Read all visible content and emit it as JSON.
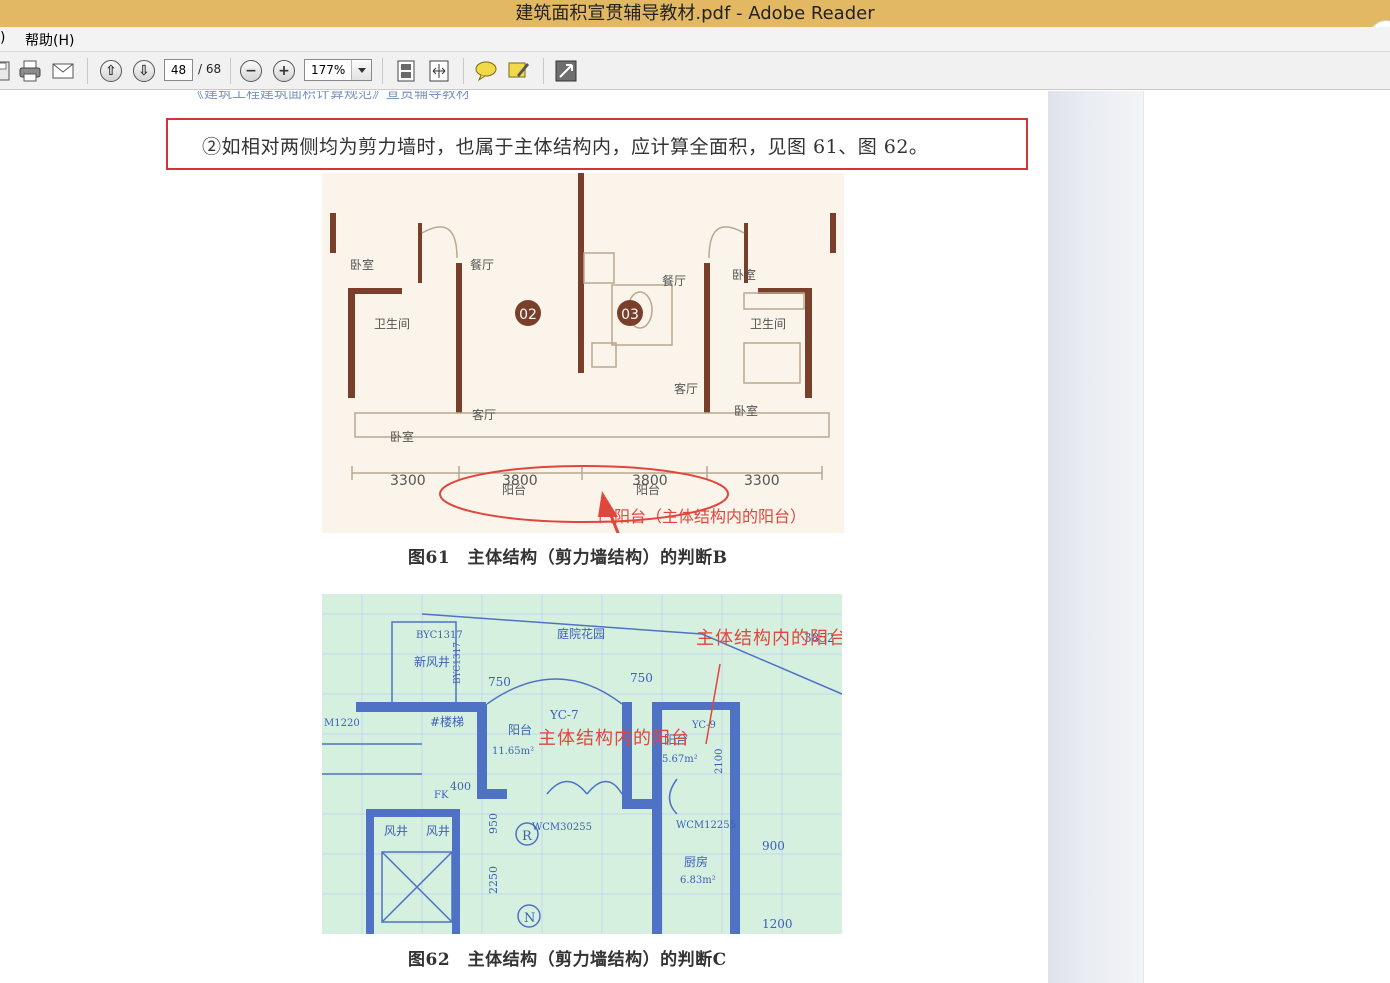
{
  "window": {
    "title": "建筑面积宣贯辅导教材.pdf - Adobe Reader"
  },
  "menubar": {
    "partial_item": ")",
    "help": "帮助(H)"
  },
  "toolbar": {
    "page_current": "48",
    "page_total": "/ 68",
    "zoom": "177%",
    "icons": [
      "save-icon",
      "print-icon",
      "email-icon",
      "prev-page-icon",
      "next-page-icon",
      "zoom-out-icon",
      "zoom-in-icon",
      "fit-page-icon",
      "fit-width-icon",
      "comment-icon",
      "highlight-icon",
      "fullscreen-icon"
    ]
  },
  "document": {
    "running_header": "《建筑工程建筑面积计算规范》宣贯辅导教材",
    "highlighted_text": "②如相对两侧均为剪力墙时，也属于主体结构内，应计算全面积，见图 61、图 62。",
    "figure61": {
      "caption": "图61　主体结构（剪力墙结构）的判断B",
      "rooms": [
        "餐厅",
        "卧室",
        "餐厅",
        "卧室",
        "卫生间",
        "卫生间",
        "卧室",
        "客厅",
        "客厅",
        "卧室",
        "阳台",
        "阳台"
      ],
      "unit_labels": [
        "02",
        "03"
      ],
      "dimensions": [
        "3300",
        "3800",
        "3800",
        "3300"
      ],
      "annotation": "凹阳台（主体结构内的阳台）"
    },
    "figure62": {
      "caption": "图62　主体结构（剪力墙结构）的判断C",
      "labels": [
        "庭院花园",
        "新风井",
        "BYC1317",
        "BYC1317",
        "750",
        "750",
        "YC-7",
        "YC-9",
        "#楼梯",
        "阳台",
        "11.65m²",
        "阳台",
        "5.67m²",
        "2100",
        "400",
        "FK",
        "风井",
        "风井",
        "WCM30255",
        "WCM12255",
        "厨房",
        "6.83m²",
        "900",
        "1200",
        "2250",
        "950",
        "3852",
        "R",
        "N",
        "M1220"
      ],
      "annotations": [
        "主体结构内的阳台",
        "主体结构内的阳台"
      ]
    }
  },
  "colors": {
    "titlebar": "#e3b863",
    "highlight_border": "#d2343c",
    "annotation_red": "#e0463c",
    "wall_brown": "#7a3f2b",
    "blueprint": "#6b8fd6"
  }
}
